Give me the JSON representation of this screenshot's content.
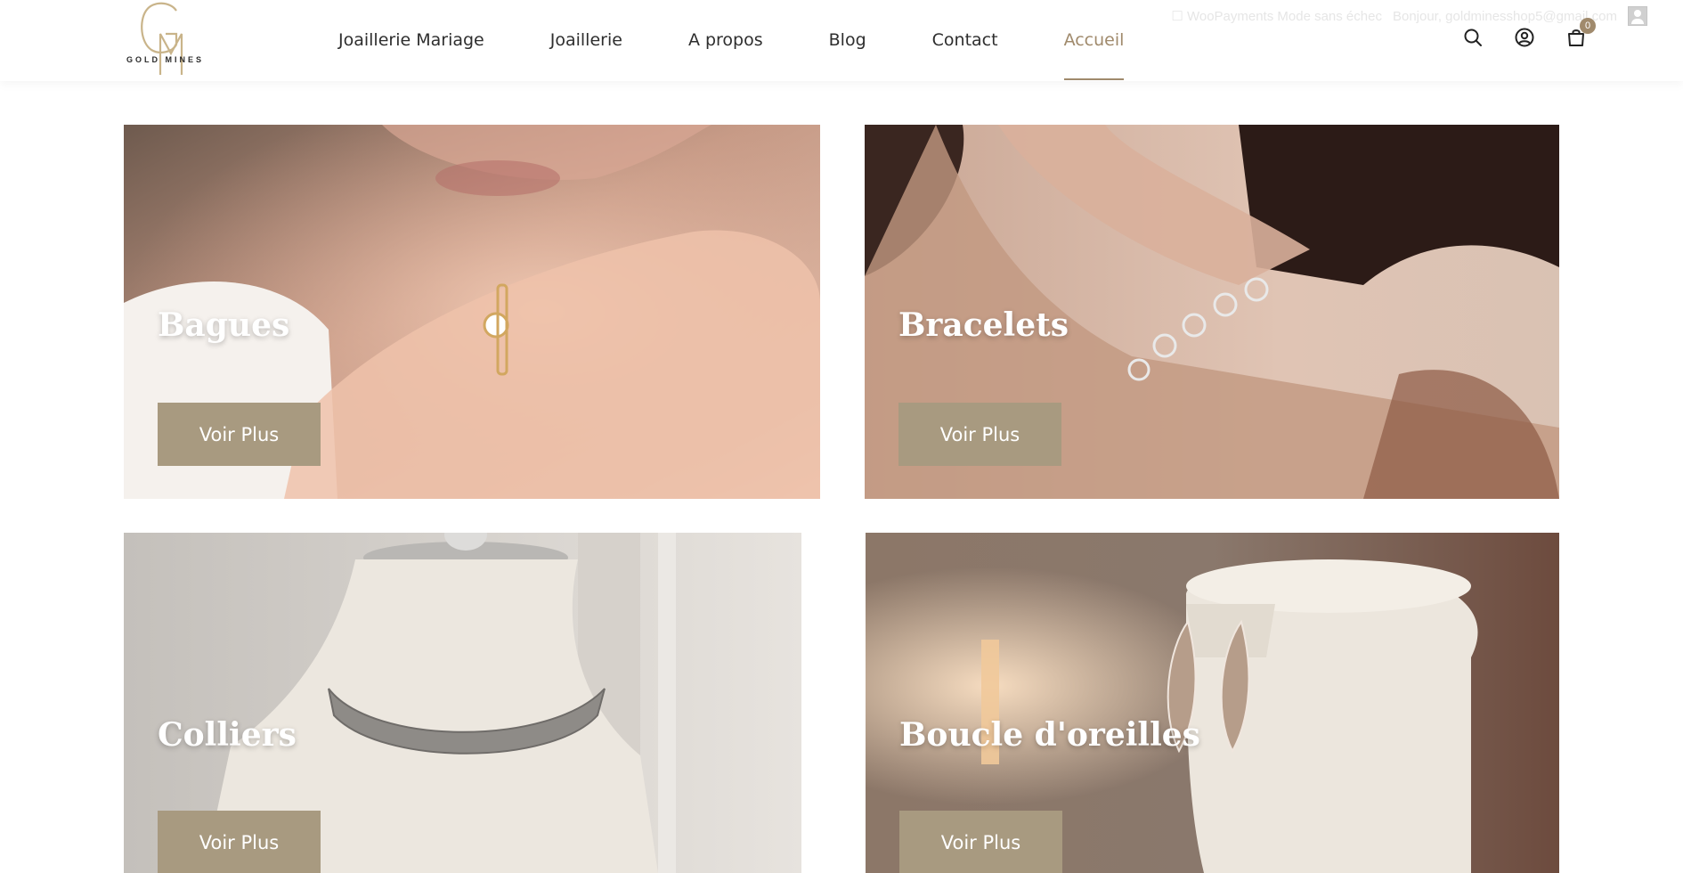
{
  "admin_notice": {
    "mode": "☐ WooPayments Mode sans échec",
    "greeting": "Bonjour, goldminesshop5@gmail.com"
  },
  "logo": {
    "monogram": "GM",
    "text": "GOLD MINES"
  },
  "nav": {
    "items": [
      {
        "label": "Joaillerie Mariage"
      },
      {
        "label": "Joaillerie"
      },
      {
        "label": "A propos"
      },
      {
        "label": "Blog"
      },
      {
        "label": "Contact"
      },
      {
        "label": "Accueil",
        "active": true
      }
    ]
  },
  "header": {
    "cart_count": "0",
    "icons": [
      "search-icon",
      "account-icon",
      "cart-icon"
    ]
  },
  "colors": {
    "accent": "#a08a6c",
    "button": "#a89a80",
    "text": "#2e2e2e"
  },
  "categories": [
    {
      "title": "Bagues",
      "button": "Voir Plus"
    },
    {
      "title": "Bracelets",
      "button": "Voir Plus"
    },
    {
      "title": "Colliers",
      "button": "Voir Plus"
    },
    {
      "title": "Boucle d'oreilles",
      "button": "Voir Plus"
    }
  ]
}
